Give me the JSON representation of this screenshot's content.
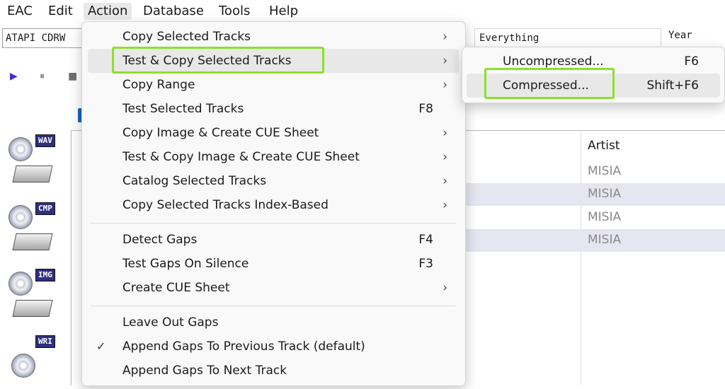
{
  "menubar": {
    "items": [
      "EAC",
      "Edit",
      "Action",
      "Database",
      "Tools",
      "Help"
    ]
  },
  "toolbar": {
    "drive_value": "ATAPI   CDRW",
    "filter_value": "Everything",
    "year_label": "Year",
    "play_glyph": "▶",
    "pause_glyph": "⏸",
    "stop_glyph": "■"
  },
  "tools": [
    {
      "badge": "WAV",
      "icon": "disc-drive-wav-icon"
    },
    {
      "badge": "CMP",
      "icon": "disc-drive-compress-icon"
    },
    {
      "badge": "IMG",
      "icon": "disc-image-icon"
    },
    {
      "badge": "WRI",
      "icon": "cue-write-icon"
    }
  ],
  "list": {
    "artist_header": "Artist",
    "rows": [
      {
        "artist": "MISIA"
      },
      {
        "artist": "MISIA"
      },
      {
        "artist": "MISIA"
      },
      {
        "artist": "MISIA"
      }
    ]
  },
  "menu": {
    "items": [
      {
        "label": "Copy Selected Tracks",
        "shortcut": "",
        "arrow": "›"
      },
      {
        "label": "Test & Copy Selected Tracks",
        "shortcut": "",
        "arrow": "›"
      },
      {
        "label": "Copy Range",
        "shortcut": "",
        "arrow": "›"
      },
      {
        "label": "Test Selected Tracks",
        "shortcut": "F8",
        "arrow": ""
      },
      {
        "label": "Copy Image & Create CUE Sheet",
        "shortcut": "",
        "arrow": "›"
      },
      {
        "label": "Test & Copy Image & Create CUE Sheet",
        "shortcut": "",
        "arrow": "›"
      },
      {
        "label": "Catalog Selected Tracks",
        "shortcut": "",
        "arrow": "›"
      },
      {
        "label": "Copy Selected Tracks Index-Based",
        "shortcut": "",
        "arrow": "›"
      },
      {
        "label": "Detect Gaps",
        "shortcut": "F4",
        "arrow": ""
      },
      {
        "label": "Test Gaps On Silence",
        "shortcut": "F3",
        "arrow": ""
      },
      {
        "label": "Create CUE Sheet",
        "shortcut": "",
        "arrow": "›"
      },
      {
        "label": "Leave Out Gaps",
        "shortcut": "",
        "arrow": ""
      },
      {
        "label": "Append Gaps To Previous Track (default)",
        "shortcut": "",
        "arrow": "",
        "check": "✓"
      },
      {
        "label": "Append Gaps To Next Track",
        "shortcut": "",
        "arrow": ""
      }
    ]
  },
  "submenu": {
    "items": [
      {
        "label": "Uncompressed...",
        "shortcut": "F6"
      },
      {
        "label": "Compressed...",
        "shortcut": "Shift+F6"
      }
    ]
  },
  "colors": {
    "highlight": "#8be02c",
    "play": "#4b2bd1",
    "accent_tab": "#1565c0",
    "row_alt": "#e6e6f1"
  }
}
